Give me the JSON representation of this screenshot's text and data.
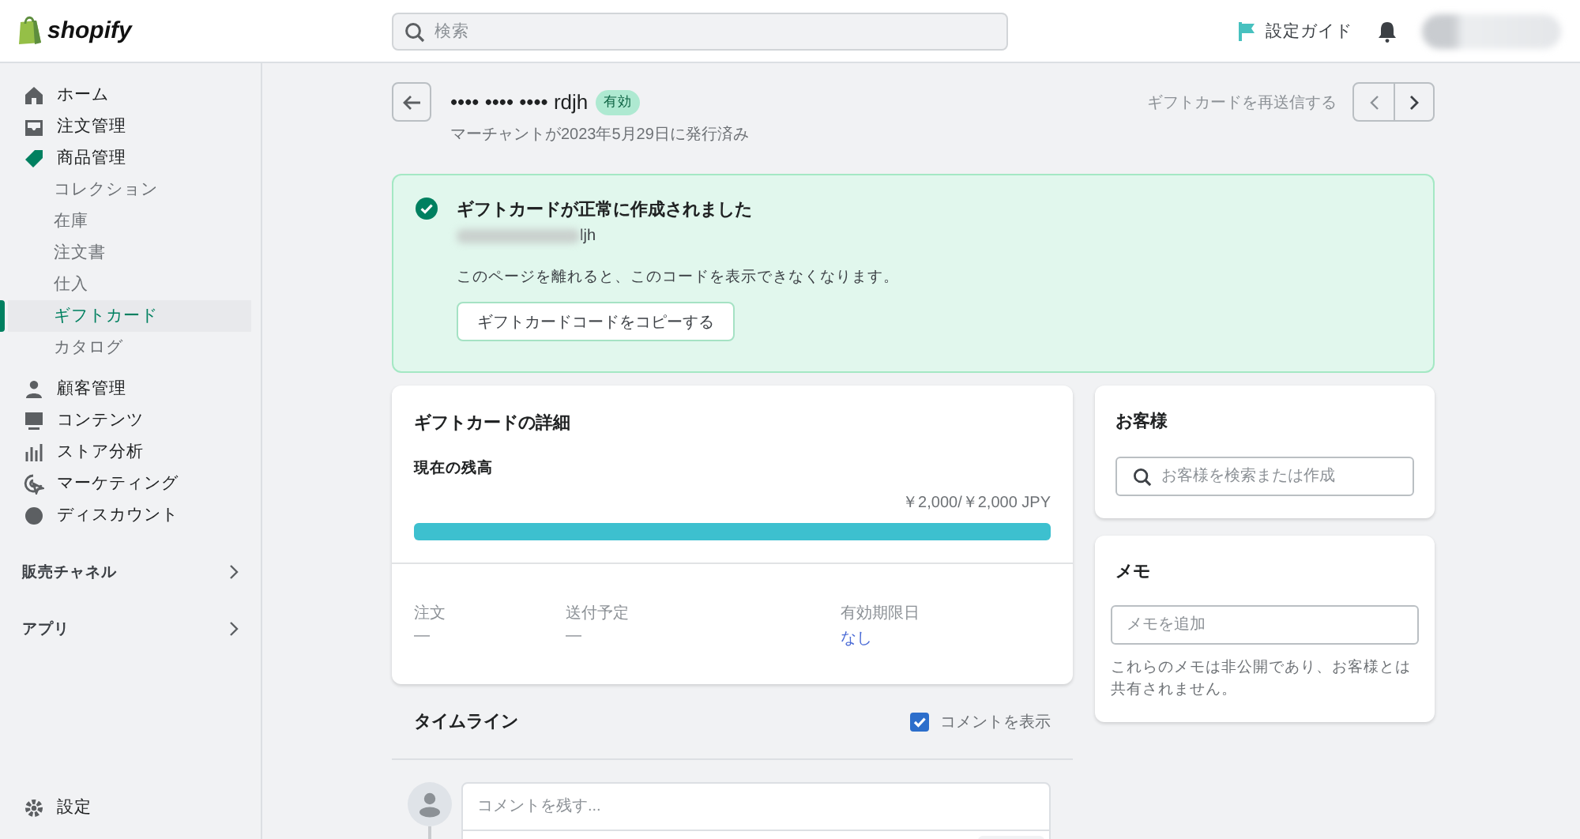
{
  "header": {
    "logo": "shopify",
    "search": {
      "placeholder": "検索"
    },
    "setup_guide": "設定ガイド"
  },
  "sidebar": {
    "items": [
      {
        "label": "ホーム",
        "selected": false
      },
      {
        "label": "注文管理",
        "selected": false
      },
      {
        "label": "商品管理",
        "selected": false,
        "children": [
          {
            "label": "コレクション",
            "selected": false
          },
          {
            "label": "在庫",
            "selected": false
          },
          {
            "label": "注文書",
            "selected": false
          },
          {
            "label": "仕入",
            "selected": false
          },
          {
            "label": "ギフトカード",
            "selected": true
          },
          {
            "label": "カタログ",
            "selected": false
          }
        ]
      },
      {
        "label": "顧客管理",
        "selected": false
      },
      {
        "label": "コンテンツ",
        "selected": false
      },
      {
        "label": "ストア分析",
        "selected": false
      },
      {
        "label": "マーケティング",
        "selected": false
      },
      {
        "label": "ディスカウント",
        "selected": false
      }
    ],
    "sections": [
      {
        "label": "販売チャネル"
      },
      {
        "label": "アプリ"
      }
    ],
    "settings": "設定"
  },
  "page": {
    "title": "•••• •••• •••• rdjh",
    "badge": "有効",
    "subtitle": "マーチャントが2023年5月29日に発行済み",
    "resend": "ギフトカードを再送信する"
  },
  "banner": {
    "title": "ギフトカードが正常に作成されました",
    "code_end": "ljh",
    "message": "このページを離れると、このコードを表示できなくなります。",
    "button": "ギフトカードコードをコピーする"
  },
  "details": {
    "title": "ギフトカードの詳細",
    "balance_label": "現在の残高",
    "balance": "￥2,000/￥2,000 JPY",
    "level": 1,
    "fields": [
      {
        "label": "注文",
        "value": "—",
        "kind": "plain"
      },
      {
        "label": "送付予定",
        "value": "—",
        "kind": "plain"
      },
      {
        "label": "有効期限日",
        "value": "なし",
        "kind": "link"
      }
    ]
  },
  "timeline": {
    "title": "タイムライン",
    "show_comments": {
      "label": "コメントを表示",
      "checked": true
    },
    "comment": {
      "placeholder": "コメントを残す..."
    }
  },
  "customer": {
    "title": "お客様",
    "search": {
      "placeholder": "お客様を検索または作成"
    }
  },
  "notes": {
    "title": "メモ",
    "field": {
      "placeholder": "メモを追加"
    },
    "help": "これらのメモは非公開であり、お客様とは共有されません。"
  }
}
